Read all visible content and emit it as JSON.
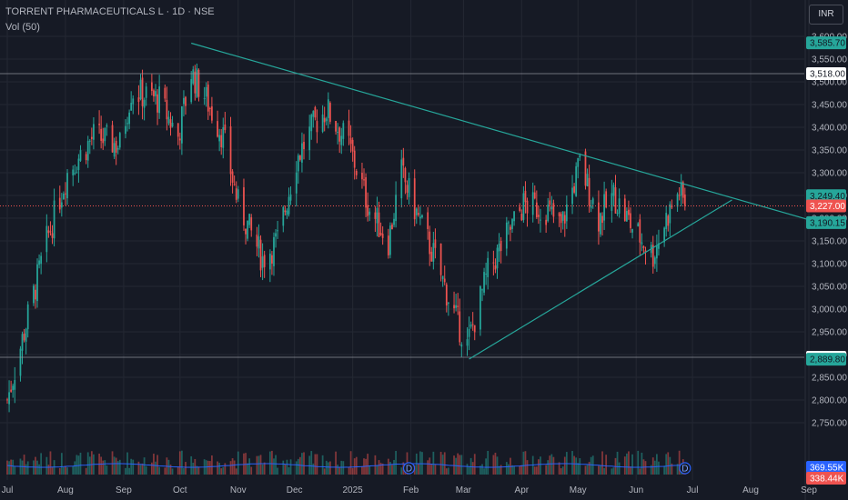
{
  "header": {
    "title": "TORRENT PHARMACEUTICALS L · 1D · NSE",
    "volume_label": "Vol (50)",
    "currency_button": "INR"
  },
  "colors": {
    "background": "#161a25",
    "grid": "#242833",
    "up": "#26a69a",
    "down": "#ef5350",
    "trendline": "#26a69a",
    "volume_ma": "#2962ff"
  },
  "chart_data": {
    "type": "candlestick",
    "symbol": "TORRENT PHARMACEUTICALS L",
    "interval": "1D",
    "exchange": "NSE",
    "ylim": [
      2700,
      3620
    ],
    "y_ticks": [
      2750,
      2800,
      2850,
      2900,
      2950,
      3000,
      3050,
      3100,
      3150,
      3200,
      3250,
      3300,
      3350,
      3400,
      3450,
      3500,
      3550,
      3600
    ],
    "x_ticks": [
      {
        "label": "Jul",
        "date": "2024-07-01"
      },
      {
        "label": "Aug",
        "date": "2024-08-01"
      },
      {
        "label": "Sep",
        "date": "2024-09-01"
      },
      {
        "label": "Oct",
        "date": "2024-10-01"
      },
      {
        "label": "Nov",
        "date": "2024-11-01"
      },
      {
        "label": "Dec",
        "date": "2024-12-01"
      },
      {
        "label": "2025",
        "date": "2025-01-01"
      },
      {
        "label": "Feb",
        "date": "2025-02-01"
      },
      {
        "label": "Mar",
        "date": "2025-03-01"
      },
      {
        "label": "Apr",
        "date": "2025-04-01"
      },
      {
        "label": "May",
        "date": "2025-05-01"
      },
      {
        "label": "Jun",
        "date": "2025-06-01"
      },
      {
        "label": "Jul",
        "date": "2025-07-01"
      },
      {
        "label": "Aug",
        "date": "2025-08-01"
      },
      {
        "label": "Sep",
        "date": "2025-09-01"
      }
    ],
    "anchors": [
      {
        "date": "2024-07-01",
        "close": 2800
      },
      {
        "date": "2024-07-10",
        "close": 2950
      },
      {
        "date": "2024-07-22",
        "close": 3150
      },
      {
        "date": "2024-08-02",
        "close": 3300
      },
      {
        "date": "2024-08-16",
        "close": 3380
      },
      {
        "date": "2024-08-30",
        "close": 3360
      },
      {
        "date": "2024-09-05",
        "close": 3480
      },
      {
        "date": "2024-09-20",
        "close": 3460
      },
      {
        "date": "2024-09-30",
        "close": 3380
      },
      {
        "date": "2024-10-07",
        "close": 3520
      },
      {
        "date": "2024-10-14",
        "close": 3470
      },
      {
        "date": "2024-10-24",
        "close": 3380
      },
      {
        "date": "2024-11-01",
        "close": 3230
      },
      {
        "date": "2024-11-14",
        "close": 3110
      },
      {
        "date": "2024-11-22",
        "close": 3150
      },
      {
        "date": "2024-12-02",
        "close": 3330
      },
      {
        "date": "2024-12-12",
        "close": 3410
      },
      {
        "date": "2024-12-18",
        "close": 3440
      },
      {
        "date": "2024-12-30",
        "close": 3360
      },
      {
        "date": "2025-01-10",
        "close": 3220
      },
      {
        "date": "2025-01-20",
        "close": 3150
      },
      {
        "date": "2025-01-27",
        "close": 3300
      },
      {
        "date": "2025-02-05",
        "close": 3200
      },
      {
        "date": "2025-02-14",
        "close": 3110
      },
      {
        "date": "2025-02-24",
        "close": 2990
      },
      {
        "date": "2025-03-03",
        "close": 2920
      },
      {
        "date": "2025-03-14",
        "close": 3080
      },
      {
        "date": "2025-03-24",
        "close": 3160
      },
      {
        "date": "2025-04-02",
        "close": 3230
      },
      {
        "date": "2025-04-14",
        "close": 3220
      },
      {
        "date": "2025-04-22",
        "close": 3180
      },
      {
        "date": "2025-05-02",
        "close": 3320
      },
      {
        "date": "2025-05-12",
        "close": 3200
      },
      {
        "date": "2025-05-20",
        "close": 3250
      },
      {
        "date": "2025-05-30",
        "close": 3180
      },
      {
        "date": "2025-06-10",
        "close": 3120
      },
      {
        "date": "2025-06-17",
        "close": 3200
      },
      {
        "date": "2025-06-24",
        "close": 3260
      },
      {
        "date": "2025-06-27",
        "close": 3227
      }
    ],
    "volume_ma_value": "369.55K",
    "volume_second_value": "338.44K",
    "horizontal_lines": [
      {
        "price": 3518.0,
        "label": "3,518.00"
      },
      {
        "price": 2894.0,
        "label": "2,894.00"
      }
    ],
    "price_tags": [
      {
        "price": 3585.7,
        "label": "3,585.70",
        "kind": "high"
      },
      {
        "price": 3249.4,
        "label": "3,249.40",
        "kind": "trend"
      },
      {
        "price": 3227.0,
        "label": "3,227.00",
        "kind": "last"
      },
      {
        "price": 3190.15,
        "label": "3,190.15",
        "kind": "trend"
      },
      {
        "price": 2889.8,
        "label": "2,889.80",
        "kind": "low"
      }
    ],
    "trendlines": [
      {
        "from": {
          "date": "2024-10-07",
          "price": 3585
        },
        "to": {
          "date": "2025-09-15",
          "price": 3180
        }
      },
      {
        "from": {
          "date": "2025-03-04",
          "price": 2890
        },
        "to": {
          "date": "2025-07-22",
          "price": 3240
        }
      }
    ],
    "events": [
      {
        "date": "2025-01-31",
        "label": "D"
      },
      {
        "date": "2025-06-27",
        "label": "D"
      }
    ]
  }
}
